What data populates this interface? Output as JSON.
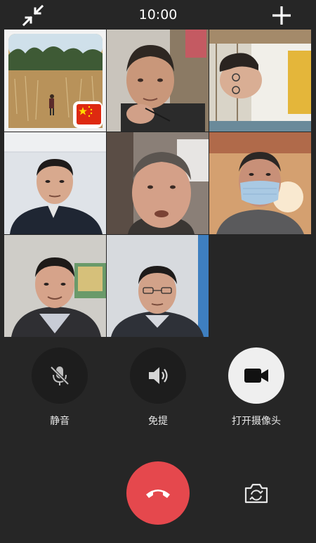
{
  "header": {
    "time": "10:00",
    "minimize_icon": "collapse-arrows-icon",
    "add_icon": "plus-icon"
  },
  "participants": [
    {
      "slot": 1,
      "type": "avatar-landscape-flag"
    },
    {
      "slot": 2,
      "type": "camera-video"
    },
    {
      "slot": 3,
      "type": "camera-video"
    },
    {
      "slot": 4,
      "type": "camera-video"
    },
    {
      "slot": 5,
      "type": "camera-video"
    },
    {
      "slot": 6,
      "type": "camera-video"
    },
    {
      "slot": 7,
      "type": "camera-video"
    },
    {
      "slot": 8,
      "type": "camera-video"
    }
  ],
  "controls": {
    "mute_label": "静音",
    "speaker_label": "免提",
    "camera_label": "打开摄像头"
  },
  "colors": {
    "background": "#262626",
    "hangup": "#e5484d",
    "button_dark": "#1d1d1d",
    "button_light": "#efefef"
  },
  "icons": {
    "mute": "mic-off-icon",
    "speaker": "speaker-icon",
    "camera": "video-camera-icon",
    "hangup": "phone-hangup-icon",
    "flip": "camera-flip-icon"
  }
}
